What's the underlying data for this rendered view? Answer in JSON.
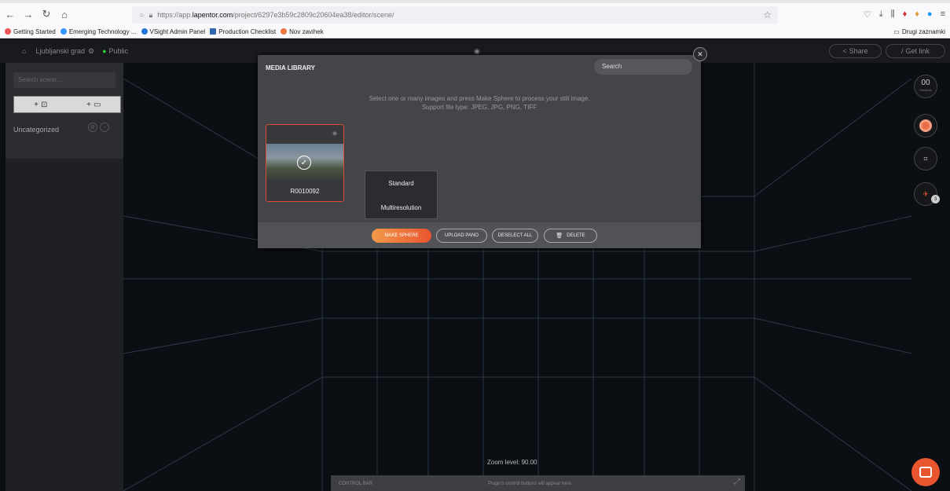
{
  "browser": {
    "url_prefix": "https://app.",
    "url_host": "lapentor.com",
    "url_path": "/project/6297e3b59c2809c20604ea38/editor/scene/",
    "bookmarks": [
      "Getting Started",
      "Emerging Technology ...",
      "VSight Admin Panel",
      "Production Checklist",
      "Nov zavihek"
    ],
    "other_bookmarks": "Drugi zaznamki"
  },
  "app": {
    "project_name": "Ljubljanski grad",
    "visibility": "Public",
    "share_label": "Share",
    "getlink_label": "Get link",
    "search_scene_placeholder": "Search scene...",
    "add_image": "+",
    "add_folder": "+",
    "group_label": "Uncategorized",
    "right_counter": "00",
    "right_counter_sub": "Hotspots",
    "badge": "3",
    "zoom_level": "Zoom level: 90.00",
    "control_bar_label": "CONTROL BAR",
    "control_bar_text": "Plugin's control buttons will appear here"
  },
  "modal": {
    "title": "MEDIA LIBRARY",
    "search_placeholder": "Search",
    "instructions_1": "Select one or many images and press Make Sphere to process your still image.",
    "instructions_2": "Support file type: JPEG, JPG, PNG, TIFF",
    "thumbnail_name": "R0010092",
    "popup_options": [
      "Standard",
      "Multiresolution"
    ],
    "buttons": {
      "make_sphere": "MAKE SPHERE",
      "upload_pano": "UPLOAD PANO",
      "deselect_all": "DESELECT ALL",
      "delete": "DELETE"
    }
  },
  "colors": {
    "accent": "#e9552f",
    "selected_border": "#e24b36"
  }
}
